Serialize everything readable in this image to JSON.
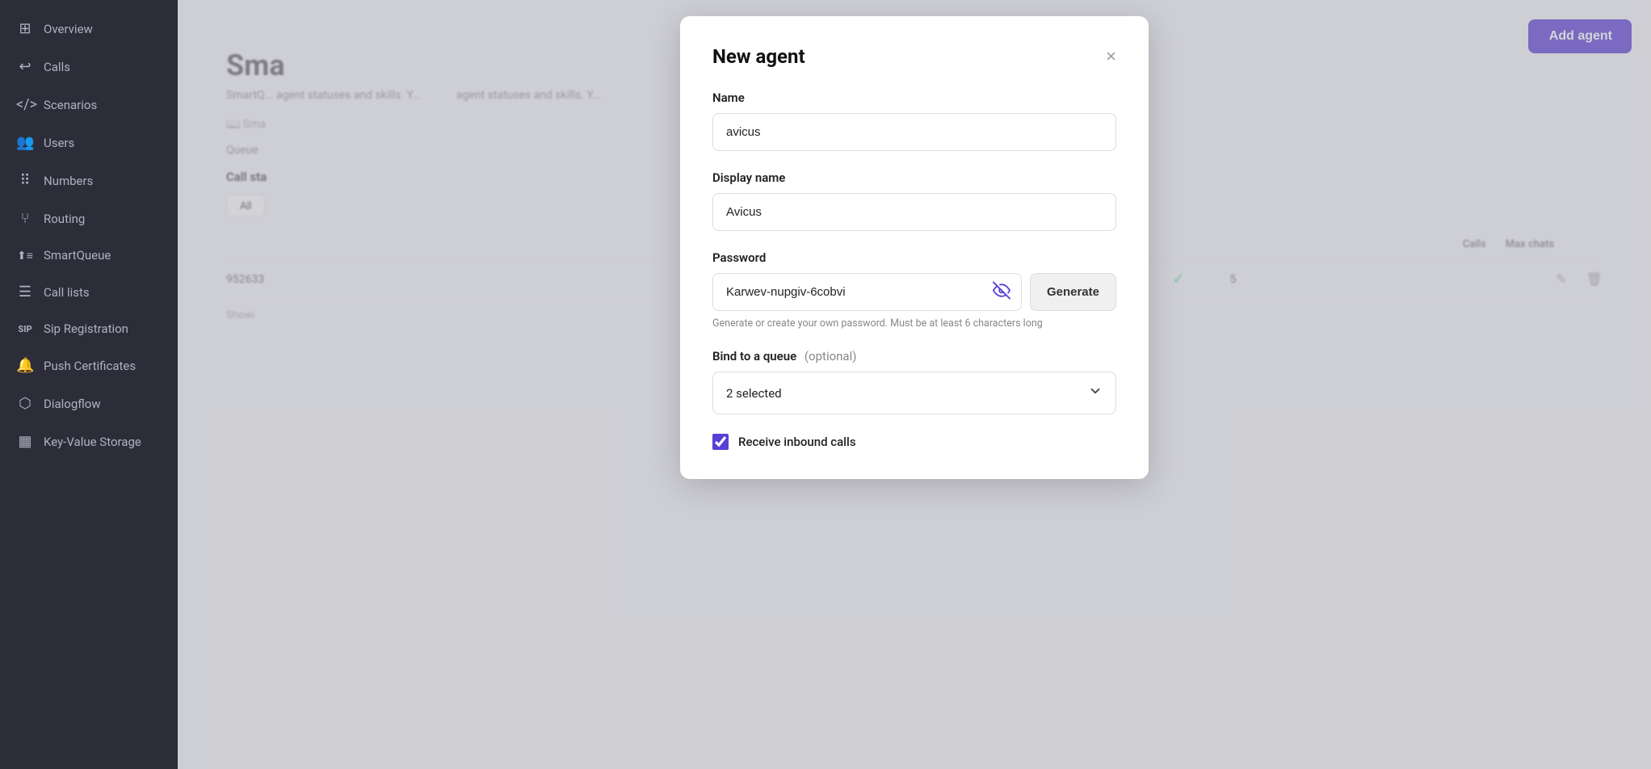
{
  "sidebar": {
    "items": [
      {
        "id": "overview",
        "label": "Overview",
        "icon": "⊞"
      },
      {
        "id": "calls",
        "label": "Calls",
        "icon": "↺"
      },
      {
        "id": "scenarios",
        "label": "Scenarios",
        "icon": "</>"
      },
      {
        "id": "users",
        "label": "Users",
        "icon": "👥"
      },
      {
        "id": "numbers",
        "label": "Numbers",
        "icon": "⠿"
      },
      {
        "id": "routing",
        "label": "Routing",
        "icon": "⑂"
      },
      {
        "id": "smartqueue",
        "label": "SmartQueue",
        "icon": "↑≡"
      },
      {
        "id": "call-lists",
        "label": "Call lists",
        "icon": "≡"
      },
      {
        "id": "sip-registration",
        "label": "Sip Registration",
        "icon": "SIP"
      },
      {
        "id": "push-certificates",
        "label": "Push Certificates",
        "icon": "⬛"
      },
      {
        "id": "dialogflow",
        "label": "Dialogflow",
        "icon": "⬡"
      },
      {
        "id": "key-value-storage",
        "label": "Key-Value Storage",
        "icon": "▦"
      }
    ]
  },
  "main": {
    "title": "Sma",
    "add_agent_label": "Add agent",
    "description": "SmartQ... agent statuses and skills. Y...",
    "smartqueue_link": "Sma",
    "queue_label": "Queue",
    "call_status_label": "Call sta",
    "filter_all": "All",
    "table_headers": [
      "Calls",
      "Max chats"
    ],
    "agent_number": "952633",
    "agent_calls_check": true,
    "agent_max_chats": "5",
    "showing_text": "Showi",
    "refresh_icon": "↺"
  },
  "modal": {
    "title": "New agent",
    "close_icon": "×",
    "name_label": "Name",
    "name_value": "avicus",
    "name_placeholder": "avicus",
    "display_name_label": "Display name",
    "display_name_value": "Avicus",
    "display_name_placeholder": "Avicus",
    "password_label": "Password",
    "password_value": "Karwev-nupgiv-6cobvi",
    "eye_icon": "👁",
    "generate_label": "Generate",
    "password_hint": "Generate or create your own password. Must be at least 6 characters long",
    "bind_queue_label": "Bind to a queue",
    "bind_queue_optional": "(optional)",
    "queue_selected_text": "2 selected",
    "chevron_icon": "⌄",
    "receive_calls_label": "Receive inbound calls",
    "receive_calls_checked": true
  },
  "colors": {
    "accent": "#5b3fd4",
    "sidebar_bg": "#2d2d3a",
    "sidebar_text": "#b0b0c0"
  }
}
